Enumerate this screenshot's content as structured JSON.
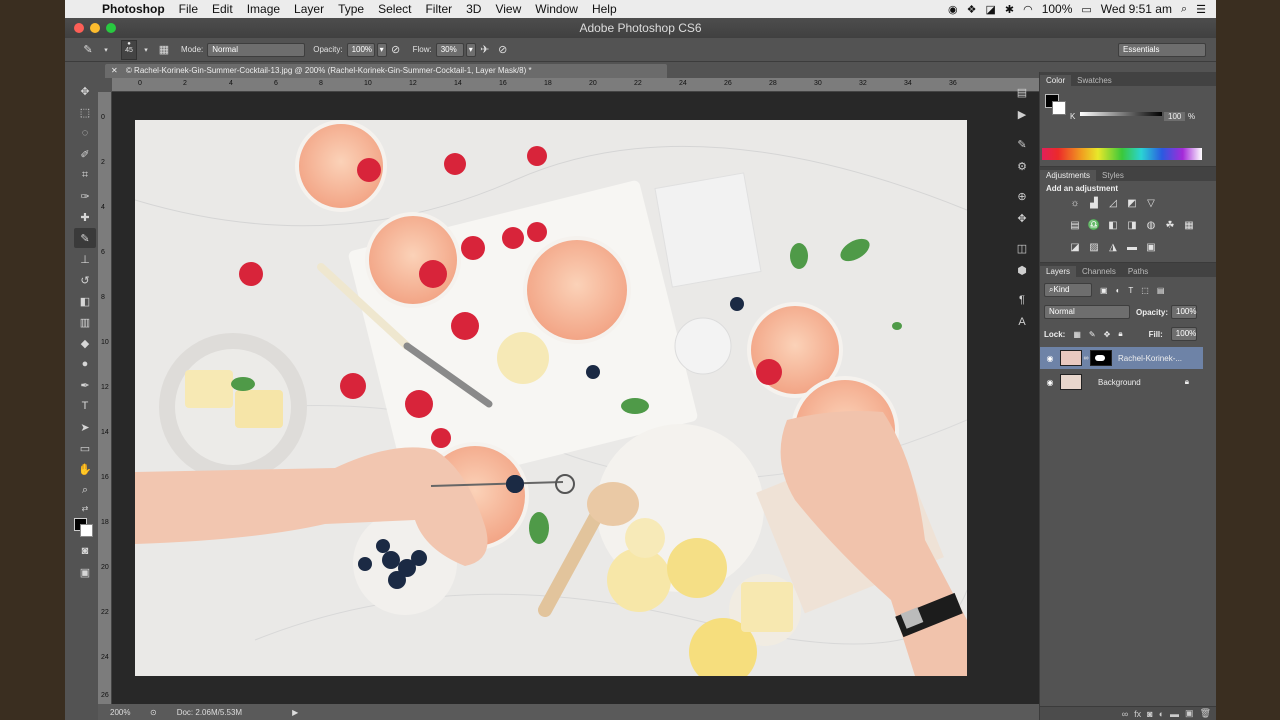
{
  "menubar": {
    "apple": "",
    "items": [
      "Photoshop",
      "File",
      "Edit",
      "Image",
      "Layer",
      "Type",
      "Select",
      "Filter",
      "3D",
      "View",
      "Window",
      "Help"
    ],
    "battery": "100%",
    "clock": "Wed 9:51 am"
  },
  "window": {
    "title": "Adobe Photoshop CS6"
  },
  "options": {
    "brush_size": "45",
    "mode_label": "Mode:",
    "mode_value": "Normal",
    "opacity_label": "Opacity:",
    "opacity_value": "100%",
    "flow_label": "Flow:",
    "flow_value": "30%",
    "workspace": "Essentials"
  },
  "document": {
    "tab_title": "© Rachel-Korinek-Gin-Summer-Cocktail-13.jpg @ 200% (Rachel-Korinek-Gin-Summer-Cocktail-1, Layer Mask/8) *",
    "ruler_h": [
      "0",
      "2",
      "4",
      "6",
      "8",
      "10",
      "12",
      "14",
      "16",
      "18",
      "20",
      "22",
      "24",
      "26",
      "28",
      "30",
      "32",
      "34",
      "36"
    ],
    "ruler_v": [
      "0",
      "2",
      "4",
      "6",
      "8",
      "10",
      "12",
      "14",
      "16",
      "18",
      "20",
      "22",
      "24",
      "26"
    ],
    "zoom": "200%",
    "doc_info": "Doc: 2.06M/5.53M"
  },
  "panels": {
    "color_tabs": [
      "Color",
      "Swatches"
    ],
    "k_label": "K",
    "k_value": "100",
    "k_unit": "%",
    "adjust_tabs": [
      "Adjustments",
      "Styles"
    ],
    "adjust_title": "Add an adjustment",
    "layers_tabs": [
      "Layers",
      "Channels",
      "Paths"
    ],
    "kind_label": "Kind",
    "blend_mode": "Normal",
    "opacity_label": "Opacity:",
    "opacity_value": "100%",
    "lock_label": "Lock:",
    "fill_label": "Fill:",
    "fill_value": "100%",
    "layers": [
      {
        "name": "Rachel-Korinek-..."
      },
      {
        "name": "Background"
      }
    ]
  },
  "colors": {
    "accent": "#6e83a7",
    "panel_bg": "#535353",
    "canvas_bg": "#282828"
  }
}
